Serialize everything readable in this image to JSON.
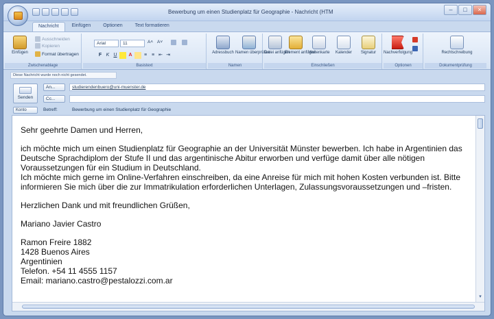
{
  "window": {
    "title": "Bewerbung um einen Studienplatz für Geographie - Nachricht (HTML)",
    "buttons": {
      "minimize": "–",
      "maximize": "□",
      "close": "×"
    }
  },
  "ribbon_tabs": [
    "Nachricht",
    "Einfügen",
    "Optionen",
    "Text formatieren"
  ],
  "ribbon": {
    "clipboard": {
      "paste_label": "Einfügen",
      "cut_label": "Ausschneiden",
      "copy_label": "Kopieren",
      "format_painter_label": "Format übertragen",
      "group_label": "Zwischenablage"
    },
    "basic_text": {
      "font_name": "Arial",
      "font_size": "11",
      "bold": "F",
      "italic": "K",
      "underline": "U",
      "font_color": "A",
      "group_label": "Basistext"
    },
    "names": {
      "address_book_label": "Adressbuch",
      "check_names_label": "Namen überprüfen",
      "group_label": "Namen"
    },
    "include": {
      "attach_file_label": "Datei anfügen",
      "attach_item_label": "Element anfügen",
      "business_card_label": "Visitenkarte",
      "calendar_label": "Kalender",
      "signature_label": "Signatur",
      "group_label": "Einschließen"
    },
    "options": {
      "followup_label": "Nachverfolgung",
      "group_label": "Optionen"
    },
    "proofing": {
      "spelling_label": "Rechtschreibung",
      "group_label": "Dokumentprüfung"
    }
  },
  "infobar": "Diese Nachricht wurde noch nicht gesendet.",
  "compose": {
    "send_label": "Senden",
    "to_label": "An...",
    "cc_label": "Cc...",
    "to_value": "studierendenbuero@uni-muenster.de",
    "cc_value": "",
    "account_label": "Konto",
    "subject_label": "Betreff:",
    "subject_value": "Bewerbung um einen Studienplatz für Geographie"
  },
  "body": {
    "greeting": "Sehr geehrte Damen und Herren,",
    "paragraph1": "ich möchte mich um einen Studienplatz für Geographie an der Universität Münster bewerben. Ich habe in Argentinien das Deutsche Sprachdiplom der Stufe II und das argentinische Abitur erworben und verfüge damit über alle nötigen Voraussetzungen für ein Studium in Deutschland.\nIch möchte mich gerne im Online-Verfahren einschreiben, da eine Anreise für mich mit hohen Kosten verbunden ist. Bitte informieren Sie mich über die zur Immatrikulation erforderlichen Unterlagen, Zulassungsvoraussetzungen und –fristen.",
    "closing": "Herzlichen Dank und mit freundlichen Grüßen,",
    "name": "Mariano Javier Castro",
    "address_lines": [
      "Ramon Freire 1882",
      "1428 Buenos Aires",
      "Argentinien",
      "Telefon. +54 11 4555 1157",
      "Email: mariano.castro@pestalozzi.com.ar"
    ]
  }
}
